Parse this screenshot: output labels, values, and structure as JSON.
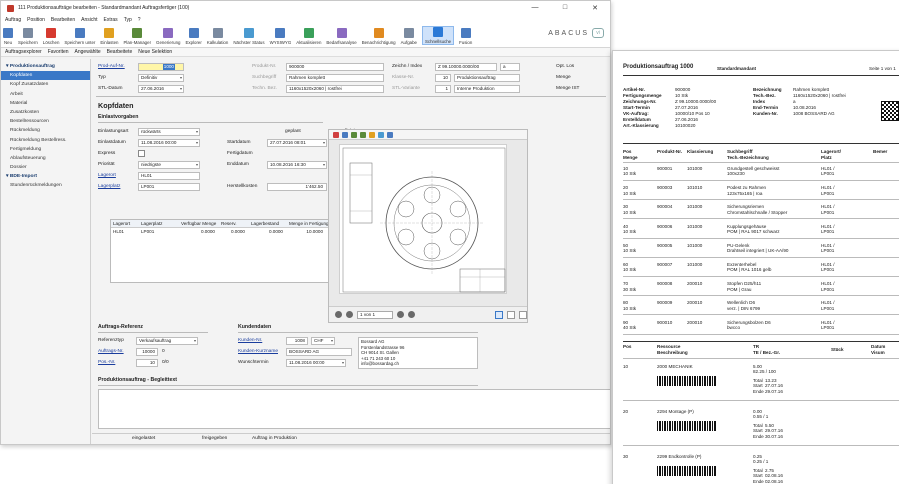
{
  "window": {
    "title": "111 Produktionsaufträge bearbeiten - Standardmandant Auftragsfertiger (100)",
    "controls": [
      "—",
      "□",
      "✕"
    ]
  },
  "menu": [
    "Auftrag",
    "Position",
    "Bearbeiten",
    "Ansicht",
    "Extras",
    "Typ",
    "?"
  ],
  "ribbon": {
    "items": [
      {
        "label": "Neu",
        "icon": "new-icon",
        "color": "#4a7bc0"
      },
      {
        "label": "Speichern",
        "icon": "save-icon",
        "color": "#7a8aa0"
      },
      {
        "label": "Löschen",
        "icon": "delete-icon",
        "color": "#d63a2f"
      },
      {
        "label": "Speichern unter",
        "icon": "save-as-icon",
        "color": "#4a7bc0"
      },
      {
        "label": "Einlasten",
        "icon": "schedule-icon",
        "color": "#e0a020"
      },
      {
        "label": "Plan-Manager",
        "icon": "plan-icon",
        "color": "#5a8a3a"
      },
      {
        "label": "Generierung",
        "icon": "generate-icon",
        "color": "#8a6ac0"
      },
      {
        "label": "Explorer",
        "icon": "explorer-icon",
        "color": "#4a7bc0"
      },
      {
        "label": "Kalkulation",
        "icon": "calculator-icon",
        "color": "#7a8aa0"
      },
      {
        "label": "Nächster Status",
        "icon": "status-icon",
        "color": "#4a9ad0"
      },
      {
        "label": "WYSIWYG",
        "icon": "preview-icon",
        "color": "#4a7bc0"
      },
      {
        "label": "Aktualisieren",
        "icon": "refresh-icon",
        "color": "#3aa05a"
      },
      {
        "label": "Bedarfsanalyse",
        "icon": "analysis-icon",
        "color": "#8a6ac0"
      },
      {
        "label": "Benachrichtigung",
        "icon": "notify-icon",
        "color": "#e08a20"
      },
      {
        "label": "Aufgabe",
        "icon": "task-icon",
        "color": "#7a8aa0"
      },
      {
        "label": "Schnellsuche",
        "icon": "quicksearch-icon",
        "color": "#2b79d6",
        "selected": true
      },
      {
        "label": "Fusion",
        "icon": "fusion-icon",
        "color": "#4a7bc0"
      }
    ],
    "logo": "ABACUS",
    "logo_mark": "vi"
  },
  "subbar": [
    "Auftragsexplorer",
    "Favoriten",
    "Angewählte",
    "Bearbeitete",
    "Neue Selektion"
  ],
  "sidebar": {
    "items": [
      {
        "label": "Produktionsauftrag",
        "kind": "head"
      },
      {
        "label": "Kopfdaten",
        "kind": "selected"
      },
      {
        "label": "Kopf Zusatzdaten",
        "kind": "item"
      },
      {
        "label": "Arbeit",
        "kind": "item"
      },
      {
        "label": "Material",
        "kind": "item"
      },
      {
        "label": "Zusatzkosten",
        "kind": "item"
      },
      {
        "label": "Bestellressourcen",
        "kind": "item"
      },
      {
        "label": "Rückmeldung",
        "kind": "item"
      },
      {
        "label": "Rückmeldung Bestellress.",
        "kind": "item"
      },
      {
        "label": "Fertigmeldung",
        "kind": "item"
      },
      {
        "label": "Ablaufsteuerung",
        "kind": "item"
      },
      {
        "label": "Dossier",
        "kind": "item"
      },
      {
        "label": "BDE-Import",
        "kind": "head"
      },
      {
        "label": "Stundenrückmeldungen",
        "kind": "item"
      }
    ]
  },
  "header": {
    "prod_auf_nr_label": "Prod-Auf-Nr.",
    "prod_auf_nr_value": "1000",
    "typ_label": "Typ",
    "typ_value": "Definitiv",
    "stl_datum_label": "STL-Datum",
    "stl_datum_value": "27.06.2016",
    "produkt_nr_label": "Produkt-Nr.",
    "produkt_nr_value": "900000",
    "suchbegriff_label": "Suchbegriff",
    "suchbegriff_value": "Rahmen komplett",
    "techn_bez_label": "Techn. Bez.",
    "techn_bez_value": "1160x1520x2060 | rostfrei",
    "zeichn_label": "Zeichn / Index",
    "zeichn_value": "Z 99.10000.0000/00",
    "zeichn_index": "a",
    "klasse_label": "Klasse-Nr.",
    "klasse_num": "10",
    "klasse_value": "Produktionsauftrag",
    "stl_variante_label": "STL-Variante",
    "stl_variante_num": "1",
    "stl_variante_value": "Interne Produktion",
    "opt_los_label": "Opt. Los",
    "menge_label": "Menge",
    "menge_ist_label": "Menge IST"
  },
  "kopfdaten": {
    "title": "Kopfdaten",
    "einlastvorgaben_title": "Einlastvorgaben",
    "einlastungsart_label": "Einlastungsart",
    "einlastungsart_value": "rückwärts",
    "einlastdatum_label": "Einlastdatum",
    "einlastdatum_value": "11.08.2016 00:00",
    "express_label": "Express",
    "prioritaet_label": "Priorität",
    "prioritaet_value": "niedrigste",
    "lagerort_label": "Lagerort",
    "lagerort_value": "HL01",
    "lagerplatz_label": "Lagerplatz",
    "lagerplatz_value": "LP001",
    "geplant_label": "geplant",
    "effektiv_label": "effektiv",
    "startdatum_label": "Startdatum",
    "startdatum_value": "27.07.2016 08:01",
    "fertigdatum_label": "Fertigdatum",
    "enddatum_label": "Enddatum",
    "enddatum_value": "10.08.2016 16:30",
    "herstellkosten_label": "Herstellkosten",
    "herstellkosten_value": "1'462.50",
    "herstellkosten_eff": "0.00"
  },
  "stock_grid": {
    "headers": [
      "Lagerort",
      "Lagerplatz",
      "Verfügbar Menge",
      "Reserv.",
      "Lagerbestand",
      "Menge in Fertigung"
    ],
    "rows": [
      [
        "HL01",
        "LP001",
        "0.0000",
        "0.0000",
        "0.0000",
        "10.0000"
      ]
    ]
  },
  "viewer": {
    "page_label": "1 von 1"
  },
  "referenz": {
    "title": "Auftrags-Referenz",
    "referenztyp_label": "Referenztyp",
    "referenztyp_value": "Verkaufsauftrag",
    "auftrag_nr_label": "Auftrags-Nr.",
    "auftrag_nr_value": "10000",
    "auftrag_nr_suffix": "0",
    "pos_nr_label": "Pos.-Nr.",
    "pos_nr_value": "10",
    "pos_nr_suffix": "0/0"
  },
  "kunden": {
    "title": "Kundendaten",
    "kunden_nr_label": "Kunden-Nr.",
    "kunden_nr_value": "1008",
    "currency": "CHF",
    "kurzname_label": "Kunden-Kurzname",
    "kurzname_value": "BOSSARD AG",
    "wunschtermin_label": "Wunschtermin",
    "wunschtermin_value": "11.08.2016 00:00",
    "address": [
      "Bossard AG",
      "Fürstenlandstrasse 96",
      "CH 9014 St. Gallen",
      "+41 71 243 60 10",
      "info@bossardag.ch"
    ]
  },
  "begleittext": {
    "title": "Produktionsauftrag - Begleittext"
  },
  "status": [
    "eingelastet",
    "freigegeben",
    "Auftrag in Produktion"
  ],
  "document": {
    "title": "Produktionsauftrag 1000",
    "mandant": "Standardmandant",
    "page": "Seite 1 von 1",
    "meta_left": [
      [
        "Artikel-Nr.",
        "900000"
      ],
      [
        "Fertigungsmenge",
        "10 Stk"
      ],
      [
        "Zeichnungs-Nr.",
        "Z 99.10000.0000/00"
      ],
      [
        "Start-Termin",
        "27.07.2016"
      ],
      [
        "VK-Auftrag:",
        "10000/10 Pos 10"
      ],
      [
        "Erstelldatum",
        "27.06.2016"
      ],
      [
        "Art.-Klassierung",
        "10100020"
      ]
    ],
    "meta_right": [
      [
        "Bezeichnung",
        "Rahmen komplett"
      ],
      [
        "Tech.-Bez.",
        "1160x1520x2060 | rostfrei"
      ],
      [
        "Index",
        "a"
      ],
      [
        "End-Termin",
        "10.08.2016"
      ],
      [
        "Kunden-Nr.",
        "1008 BOSSARD AG"
      ]
    ],
    "table_headers": [
      [
        "Pos",
        "Menge"
      ],
      [
        "Produkt-Nr.",
        ""
      ],
      [
        "Klassierung",
        ""
      ],
      [
        "Suchbegriff",
        "Tech.-Bezeichnung"
      ],
      [
        "Lagerort/",
        "Platz"
      ],
      [
        "Bemer",
        ""
      ]
    ],
    "rows": [
      [
        "10",
        "10 Stk",
        "900001",
        "101000",
        "Grundgestell geschweisst",
        "100x230",
        "HL01 /",
        "LP001"
      ],
      [
        "20",
        "10 Stk",
        "900003",
        "101010",
        "Podest zu Rahmen",
        "123x75x165 | roa",
        "HL01 /",
        "LP001"
      ],
      [
        "30",
        "10 Stk",
        "900004",
        "101000",
        "Sicherungsriemen",
        "Chromstahlschnalle / Stopper",
        "HL01 /",
        "LP001"
      ],
      [
        "40",
        "10 Stk",
        "900006",
        "101000",
        "Kupplungsgehäuse",
        "POM | RAL 9017 schwarz",
        "HL01 /",
        "LP001"
      ],
      [
        "50",
        "10 Stk",
        "900005",
        "101000",
        "PU-Gelenk",
        "Drahtseil integriert | UK-AA/90",
        "HL01 /",
        "LP001"
      ],
      [
        "60",
        "10 Stk",
        "900007",
        "101000",
        "Exzenterhebel",
        "POM | RAL 1016 gelb",
        "HL01 /",
        "LP001"
      ],
      [
        "70",
        "30 Stk",
        "900008",
        "200010",
        "Stopfen D25/h11",
        "POM | Grau",
        "HL01 /",
        "LP001"
      ],
      [
        "80",
        "10 Stk",
        "900009",
        "200010",
        "Wellenlich D6",
        "verz. | DIN 6799",
        "HL01 /",
        "LP001"
      ],
      [
        "90",
        "40 Stk",
        "900010",
        "200010",
        "Sicherungsbolzen D6",
        "bwcco",
        "HL01 /",
        "LP001"
      ]
    ],
    "ops_headers": [
      "Pos",
      "Ressource",
      "Beschreibung",
      "TR",
      "TE / Bez.-Gr.",
      "Stück",
      "Datum",
      "Visum"
    ],
    "ops": [
      {
        "pos": "10",
        "res": "2000 MECHANIK",
        "tr": "5.00",
        "te": "82.25 / 100",
        "total": "13.23",
        "start": "27.07.16",
        "ende": "29.07.16"
      },
      {
        "pos": "20",
        "res": "2294 Montage (P)",
        "tr": "0.00",
        "te": "0.55 / 1",
        "total": "5.50",
        "start": "29.07.16",
        "ende": "30.07.16"
      },
      {
        "pos": "30",
        "res": "2299 Endkontrolle (P)",
        "tr": "0.25",
        "te": "0.25 / 1",
        "total": "2.75",
        "start": "02.08.16",
        "ende": "02.08.16"
      }
    ],
    "labels": {
      "total": "Total",
      "start": "Start",
      "ende": "Ende"
    }
  }
}
